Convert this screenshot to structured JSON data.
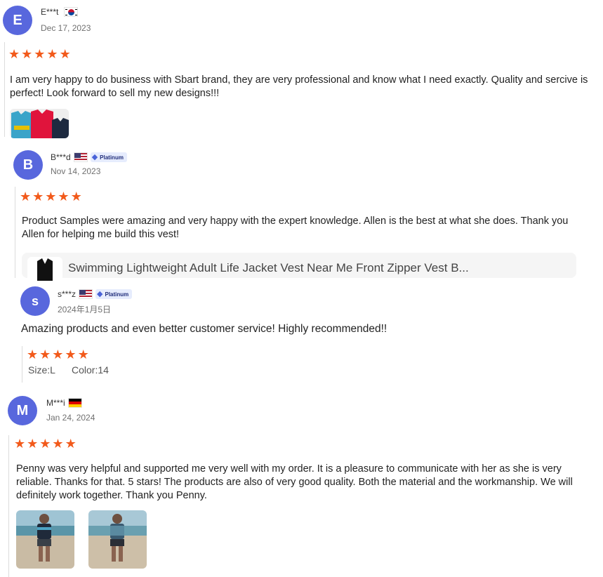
{
  "reviews": [
    {
      "initial": "E",
      "name": "E***t",
      "country": "kr",
      "date": "Dec 17, 2023",
      "rating": 5,
      "text": "I am very happy to do business with Sbart brand, they are very professional and know what I need exactly. Quality and sercive is perfect! Look forward to sell my new designs!!!"
    },
    {
      "initial": "B",
      "name": "B***d",
      "country": "us",
      "badge": "Platinum",
      "date": "Nov 14, 2023",
      "rating": 5,
      "text": "Product Samples were amazing and very happy with the expert knowledge. Allen is the best at what she does. Thank you Allen for helping me build this vest!",
      "product_title": "Swimming Lightweight Adult Life Jacket Vest Near Me Front Zipper Vest B..."
    },
    {
      "initial": "s",
      "name": "s***z",
      "country": "us",
      "badge": "Platinum",
      "date": "2024年1月5日",
      "rating": 5,
      "text": "Amazing products and even better customer service! Highly recommended!!",
      "size_label": "Size:",
      "size_value": "L",
      "color_label": "Color:",
      "color_value": "14"
    },
    {
      "initial": "M",
      "name": "M***i",
      "country": "de",
      "date": "Jan 24, 2024",
      "rating": 5,
      "text": "Penny was very helpful and supported me very well with my order. It is a pleasure to communicate with her as she is very reliable. Thanks for that. 5 stars! The products are also of very good quality. Both the material and the workmanship. We will definitely work together. Thank you Penny."
    }
  ],
  "colors": {
    "avatar": "#5867dd",
    "star": "#f25a1b",
    "badge_bg": "#e6ecfd"
  },
  "icons": {
    "star": "★",
    "verified": "◆"
  }
}
